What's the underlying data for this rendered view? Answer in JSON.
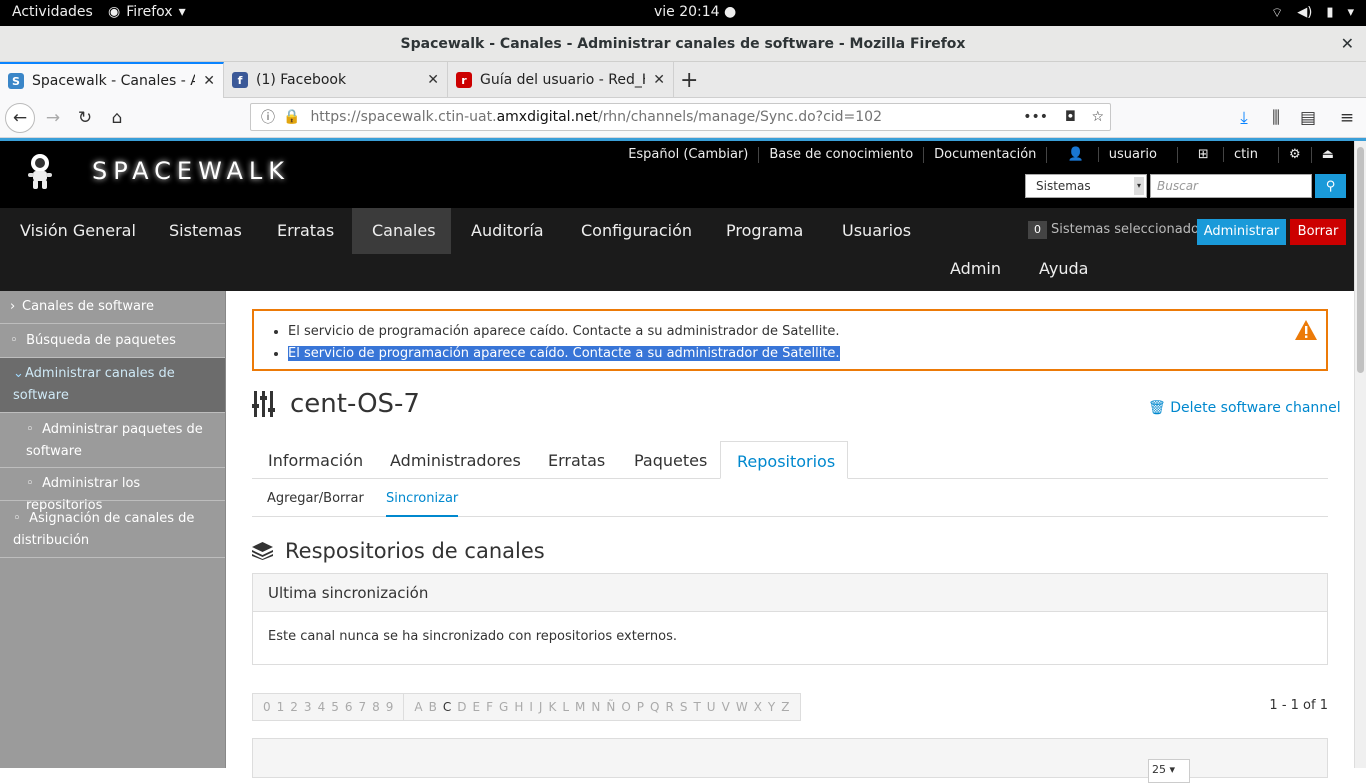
{
  "gnome": {
    "activities": "Actividades",
    "app": "Firefox",
    "clock": "vie 20:14"
  },
  "window": {
    "title": "Spacewalk - Canales - Administrar canales de software - Mozilla Firefox"
  },
  "browser": {
    "tabs": [
      {
        "title": "Spacewalk - Canales - Ad",
        "active": true
      },
      {
        "title": "(1) Facebook",
        "active": false
      },
      {
        "title": "Guía del usuario - Red_Ha",
        "active": false
      }
    ],
    "url_prefix": "https://spacewalk.ctin-uat.",
    "url_domain": "amxdigital.net",
    "url_path": "/rhn/channels/manage/Sync.do?cid=102"
  },
  "spacewalk": {
    "logo_text": "SPACEWALK",
    "top_links": [
      "Español (Cambiar)",
      "Base de conocimiento",
      "Documentación",
      "usuario",
      "ctin"
    ],
    "system_select": "Sistemas",
    "search_placeholder": "Buscar",
    "main_nav": [
      "Visión General",
      "Sistemas",
      "Erratas",
      "Canales",
      "Auditoría",
      "Configuración",
      "Programa",
      "Usuarios"
    ],
    "main_nav2": [
      "Admin",
      "Ayuda"
    ],
    "selected_count": "0",
    "selected_label": "Sistemas seleccionados",
    "admin_button": "Administrar",
    "delete_button": "Borrar"
  },
  "sidebar": {
    "items": [
      {
        "label": "Canales de software"
      },
      {
        "label": "Búsqueda de paquetes"
      },
      {
        "label": "Administrar canales de software"
      },
      {
        "label": "Administrar paquetes de software"
      },
      {
        "label": "Administrar los repositorios"
      },
      {
        "label": "Asignación de canales de distribución"
      }
    ]
  },
  "alert": {
    "messages": [
      "El servicio de programación aparece caído. Contacte a su administrador de Satellite.",
      "El servicio de programación aparece caído. Contacte a su administrador de Satellite."
    ]
  },
  "channel": {
    "name": "cent-OS-7",
    "delete_link": "Delete software channel",
    "tabs": [
      "Información",
      "Administradores",
      "Erratas",
      "Paquetes",
      "Repositorios"
    ],
    "subtabs": [
      "Agregar/Borrar",
      "Sincronizar"
    ]
  },
  "repos": {
    "title": "Respositorios de canales",
    "panel_header": "Ultima sincronización",
    "panel_body": "Este canal nunca se ha sincronizado con repositorios externos.",
    "digits": [
      "0",
      "1",
      "2",
      "3",
      "4",
      "5",
      "6",
      "7",
      "8",
      "9"
    ],
    "letters": [
      "A",
      "B",
      "C",
      "D",
      "E",
      "F",
      "G",
      "H",
      "I",
      "J",
      "K",
      "L",
      "M",
      "N",
      "Ñ",
      "O",
      "P",
      "Q",
      "R",
      "S",
      "T",
      "U",
      "V",
      "W",
      "X",
      "Y",
      "Z"
    ],
    "enabled_letter": "C",
    "count_text": "1 - 1 of 1",
    "page_size": "25"
  },
  "colors": {
    "accent": "#0088ce",
    "warning": "#ec7a08",
    "danger": "#cc0000",
    "admin": "#1a9ad9"
  }
}
